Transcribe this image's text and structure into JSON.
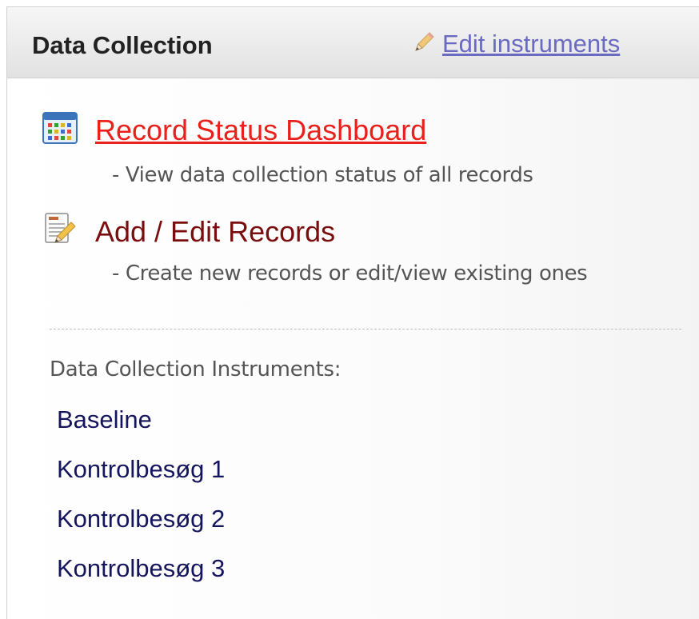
{
  "panel": {
    "title": "Data Collection",
    "edit_link": {
      "label": "Edit instruments",
      "icon": "pencil-icon"
    }
  },
  "links": [
    {
      "label": "Record Status Dashboard",
      "description": "- View data collection status of all records",
      "icon": "dashboard-grid-icon",
      "color": "#e8211c"
    },
    {
      "label": "Add / Edit Records",
      "description": "- Create new records or edit/view existing ones",
      "icon": "edit-records-icon",
      "color": "#7a0e0e"
    }
  ],
  "instruments": {
    "heading": "Data Collection Instruments:",
    "items": [
      "Baseline",
      "Kontrolbesøg 1",
      "Kontrolbesøg 2",
      "Kontrolbesøg 3"
    ]
  }
}
